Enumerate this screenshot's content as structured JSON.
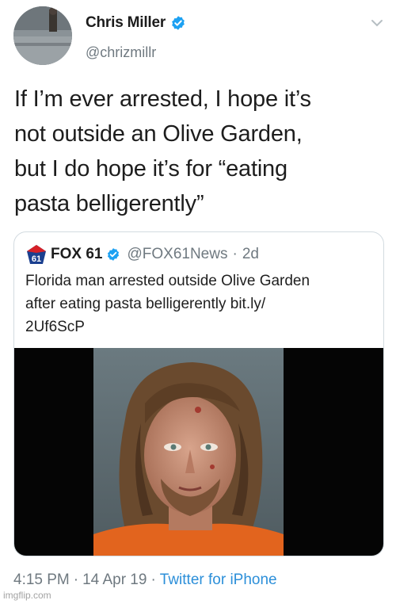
{
  "tweet": {
    "author_name": "Chris Miller",
    "author_handle": "@chrizmillr",
    "text": "If I’m ever arrested, I hope it’s\nnot outside an Olive Garden,\nbut I do hope it’s for “eating\npasta belligerently”",
    "time": "4:15 PM",
    "date": "14 Apr 19",
    "source": "Twitter for iPhone",
    "separator": "·"
  },
  "quoted": {
    "author_name": "FOX 61",
    "author_handle": "@FOX61News",
    "separator": "·",
    "age": "2d",
    "text": "Florida man arrested outside Olive Garden\nafter eating pasta belligerently bit.ly/\n2Uf6ScP",
    "logo_text": "61"
  },
  "watermark": "imgflip.com",
  "colors": {
    "verified": "#1da1f2",
    "link": "#2c8fd9",
    "secondary_text": "#6f7980",
    "card_border": "#d3dbe0"
  },
  "icons": {
    "verified": "verified-badge-icon",
    "menu": "chevron-down-icon",
    "logo": "fox61-logo"
  }
}
